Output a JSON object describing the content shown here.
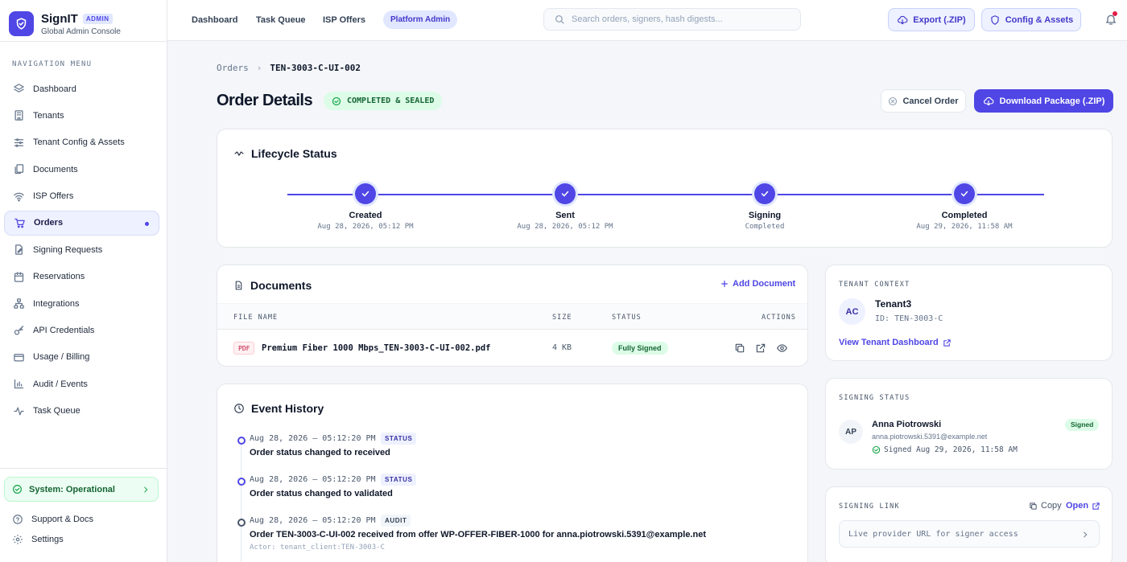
{
  "brand": {
    "name": "SignIT",
    "badge": "ADMIN",
    "subtitle": "Global Admin Console"
  },
  "sidebar": {
    "heading": "NAVIGATION MENU",
    "items": [
      {
        "label": "Dashboard",
        "icon": "layers-icon"
      },
      {
        "label": "Tenants",
        "icon": "building-icon"
      },
      {
        "label": "Tenant Config & Assets",
        "icon": "sliders-icon"
      },
      {
        "label": "Documents",
        "icon": "files-icon"
      },
      {
        "label": "ISP Offers",
        "icon": "wifi-icon"
      },
      {
        "label": "Orders",
        "icon": "cart-icon",
        "active": true
      },
      {
        "label": "Signing Requests",
        "icon": "pen-document-icon"
      },
      {
        "label": "Reservations",
        "icon": "calendar-icon"
      },
      {
        "label": "Integrations",
        "icon": "network-icon"
      },
      {
        "label": "API Credentials",
        "icon": "key-icon"
      },
      {
        "label": "Usage / Billing",
        "icon": "credit-card-icon"
      },
      {
        "label": "Audit / Events",
        "icon": "bar-chart-icon"
      },
      {
        "label": "Task Queue",
        "icon": "activity-icon"
      }
    ],
    "system_status": "System: Operational",
    "support": "Support & Docs",
    "settings": "Settings"
  },
  "topbar": {
    "nav": [
      "Dashboard",
      "Task Queue",
      "ISP Offers",
      "Platform Admin"
    ],
    "active_nav": "Platform Admin",
    "search_placeholder": "Search orders, signers, hash digests...",
    "export_label": "Export (.ZIP)",
    "config_label": "Config & Assets"
  },
  "breadcrumb": {
    "root": "Orders",
    "current": "TEN-3003-C-UI-002"
  },
  "page": {
    "title": "Order Details",
    "status": "COMPLETED & SEALED",
    "cancel_label": "Cancel Order",
    "download_label": "Download Package (.ZIP)"
  },
  "lifecycle": {
    "title": "Lifecycle Status",
    "steps": [
      {
        "label": "Created",
        "sub": "Aug 28, 2026, 05:12 PM"
      },
      {
        "label": "Sent",
        "sub": "Aug 28, 2026, 05:12 PM"
      },
      {
        "label": "Signing",
        "sub": "Completed"
      },
      {
        "label": "Completed",
        "sub": "Aug 29, 2026, 11:58 AM"
      }
    ]
  },
  "documents": {
    "title": "Documents",
    "add_label": "Add Document",
    "columns": [
      "FILE NAME",
      "SIZE",
      "STATUS",
      "ACTIONS"
    ],
    "rows": [
      {
        "type": "PDF",
        "name": "Premium Fiber 1000 Mbps_TEN-3003-C-UI-002.pdf",
        "size": "4 KB",
        "status": "Fully Signed"
      }
    ]
  },
  "tenant": {
    "caption": "TENANT CONTEXT",
    "initials": "AC",
    "name": "Tenant3",
    "id": "ID: TEN-3003-C",
    "link": "View Tenant Dashboard"
  },
  "signing_status": {
    "caption": "SIGNING STATUS",
    "initials": "AP",
    "name": "Anna Piotrowski",
    "email": "anna.piotrowski.5391@example.net",
    "signed_at": "Signed Aug 29, 2026, 11:58 AM",
    "badge": "Signed"
  },
  "signing_link": {
    "caption": "SIGNING LINK",
    "copy": "Copy",
    "open": "Open",
    "url_text": "Live provider URL for signer access"
  },
  "events": {
    "title": "Event History",
    "items": [
      {
        "time": "Aug 28, 2026 – 05:12:20 PM",
        "tag": "STATUS",
        "message": "Order status changed to received",
        "actor": ""
      },
      {
        "time": "Aug 28, 2026 – 05:12:20 PM",
        "tag": "STATUS",
        "message": "Order status changed to validated",
        "actor": ""
      },
      {
        "time": "Aug 28, 2026 – 05:12:20 PM",
        "tag": "AUDIT",
        "message": "Order TEN-3003-C-UI-002 received from offer WP-OFFER-FIBER-1000 for anna.piotrowski.5391@example.net",
        "actor": "Actor: tenant_client:TEN-3003-C"
      }
    ]
  },
  "colors": {
    "accent": "#4f46e5",
    "success": "#166534",
    "success_bg": "#dcfce7",
    "alert": "#e11d48"
  }
}
